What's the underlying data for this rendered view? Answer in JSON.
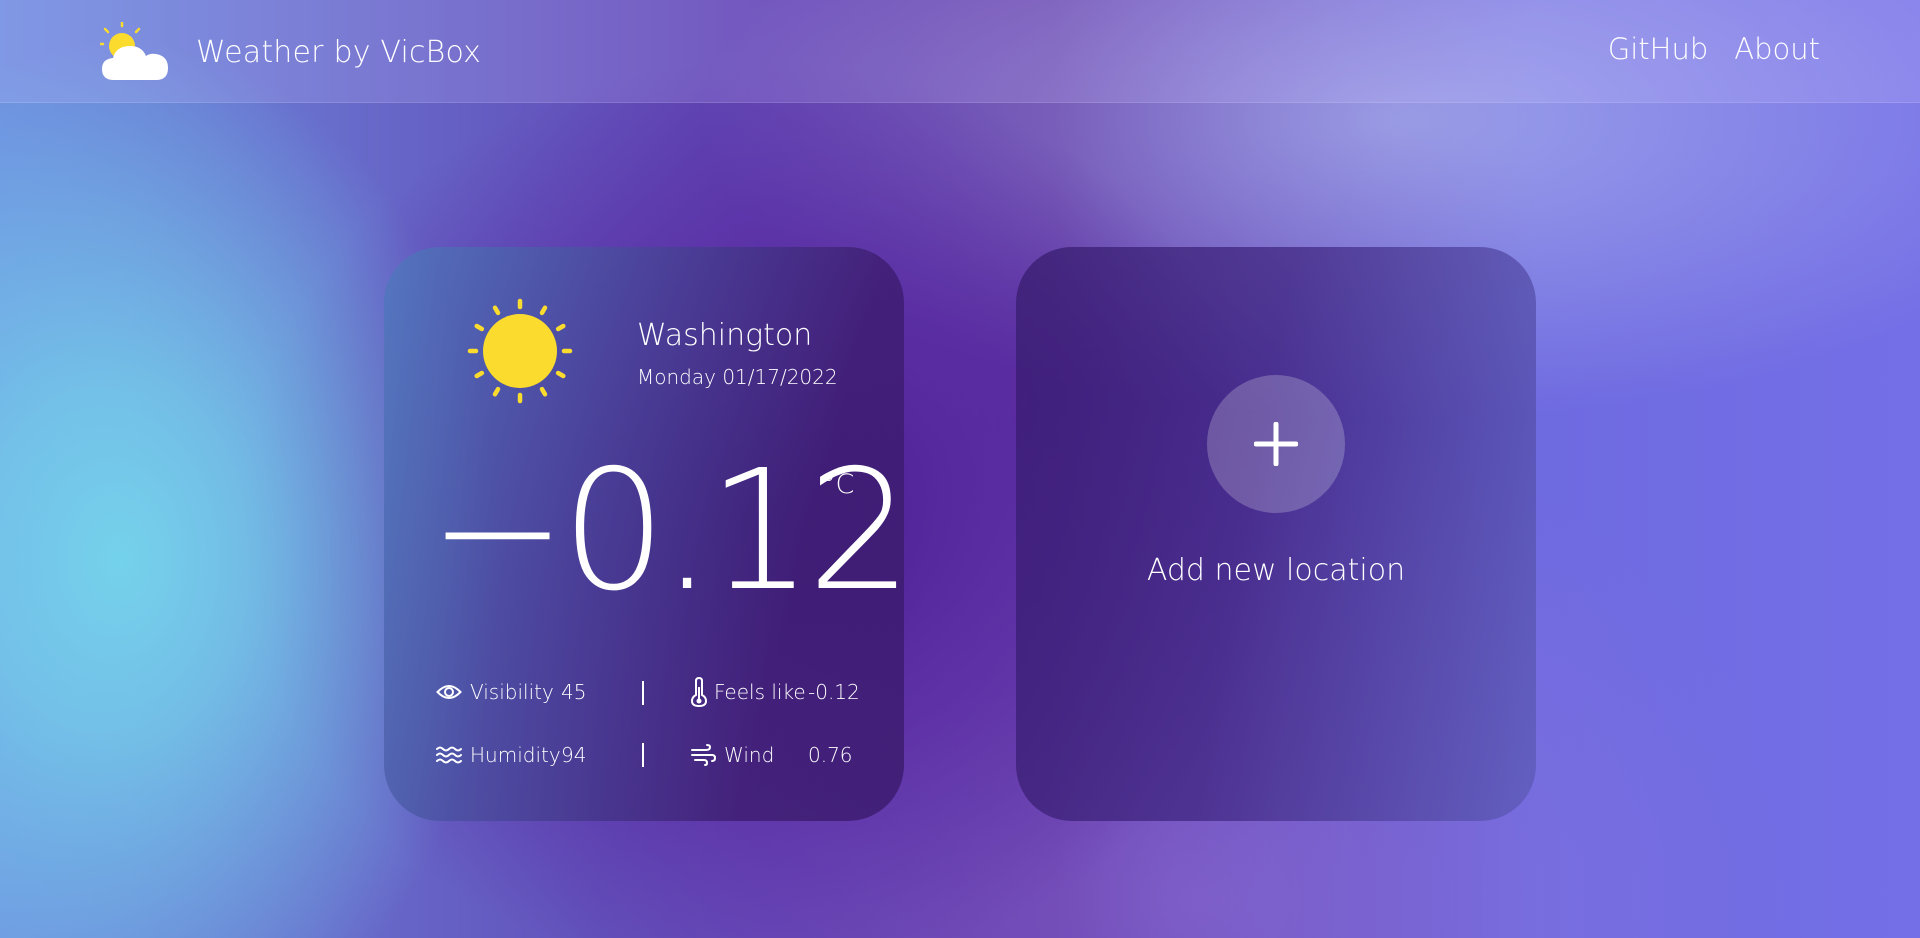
{
  "app": {
    "title": "Weather by VicBox",
    "logo_icon": "partly-cloudy-icon"
  },
  "nav": {
    "links": [
      {
        "label": "GitHub"
      },
      {
        "label": "About"
      }
    ]
  },
  "weather_card": {
    "icon": "sun-icon",
    "city": "Washington",
    "date": "Monday 01/17/2022",
    "temperature": "−0.12",
    "unit": "°C",
    "stats": {
      "visibility": {
        "label": "Visibility",
        "value": "45",
        "icon": "eye-icon"
      },
      "feels_like": {
        "label": "Feels like",
        "value": "-0.12",
        "icon": "thermometer-icon"
      },
      "humidity": {
        "label": "Humidity",
        "value": "94",
        "icon": "humidity-waves-icon"
      },
      "wind": {
        "label": "Wind",
        "value": "0.76",
        "icon": "wind-icon"
      }
    }
  },
  "add_card": {
    "icon": "plus-icon",
    "label": "Add new location"
  },
  "colors": {
    "sun": "#fbdc2e",
    "cloud": "#ffffff",
    "text": "#ffffff"
  }
}
